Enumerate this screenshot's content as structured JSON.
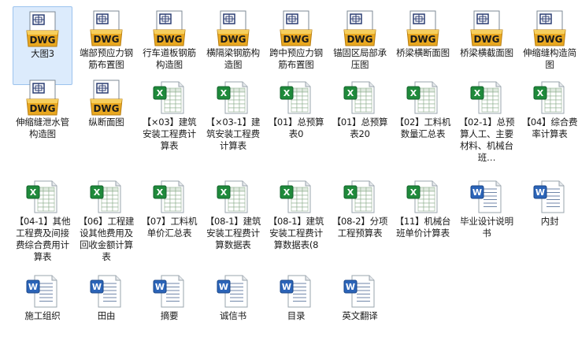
{
  "files": [
    {
      "name": "大图3",
      "type": "dwg",
      "selected": true
    },
    {
      "name": "端部预应力钢筋布置图",
      "type": "dwg"
    },
    {
      "name": "行车道板钢筋构造图",
      "type": "dwg"
    },
    {
      "name": "横隔梁钢筋构造图",
      "type": "dwg"
    },
    {
      "name": "跨中预应力钢筋布置图",
      "type": "dwg"
    },
    {
      "name": "锚固区局部承压图",
      "type": "dwg"
    },
    {
      "name": "桥梁横断面图",
      "type": "dwg"
    },
    {
      "name": "桥梁横截面图",
      "type": "dwg"
    },
    {
      "name": "伸缩缝构造简图",
      "type": "dwg"
    },
    {
      "name": "伸缩缝泄水管构造图",
      "type": "dwg"
    },
    {
      "name": "纵断面图",
      "type": "dwg"
    },
    {
      "name": "【×03】建筑安装工程费计算表",
      "type": "xls"
    },
    {
      "name": "【×03-1】建筑安装工程费计算表",
      "type": "xls"
    },
    {
      "name": "【01】总预算表0",
      "type": "xls"
    },
    {
      "name": "【01】总预算表20",
      "type": "xls"
    },
    {
      "name": "【02】工料机数量汇总表",
      "type": "xls"
    },
    {
      "name": "【02-1】总预算人工、主要材料、机械台班…",
      "type": "xls"
    },
    {
      "name": "【04】综合费率计算表",
      "type": "xls"
    },
    {
      "name": "【04-1】其他工程费及间接费综合费用计算表",
      "type": "xls"
    },
    {
      "name": "【06】工程建设其他费用及回收金额计算表",
      "type": "xls"
    },
    {
      "name": "【07】工料机单价汇总表",
      "type": "xls"
    },
    {
      "name": "【08-1】建筑安装工程费计算数据表",
      "type": "xls"
    },
    {
      "name": "【08-1】建筑安装工程费计算数据表(8",
      "type": "xls"
    },
    {
      "name": "【08-2】分项工程预算表",
      "type": "xls"
    },
    {
      "name": "【11】机械台班单价计算表",
      "type": "xls"
    },
    {
      "name": "毕业设计说明书",
      "type": "doc"
    },
    {
      "name": "内封",
      "type": "doc"
    },
    {
      "name": "施工组织",
      "type": "doc"
    },
    {
      "name": "田由",
      "type": "doc"
    },
    {
      "name": "摘要",
      "type": "doc"
    },
    {
      "name": "诚信书",
      "type": "doc"
    },
    {
      "name": "目录",
      "type": "doc"
    },
    {
      "name": "英文翻译",
      "type": "doc"
    }
  ],
  "icon_text": {
    "dwg": "DWG"
  },
  "colors": {
    "selection": "#dcebfc",
    "excel_green": "#1f8a3b",
    "word_blue": "#2b64b8",
    "dwg_gold": "#e9a820"
  }
}
